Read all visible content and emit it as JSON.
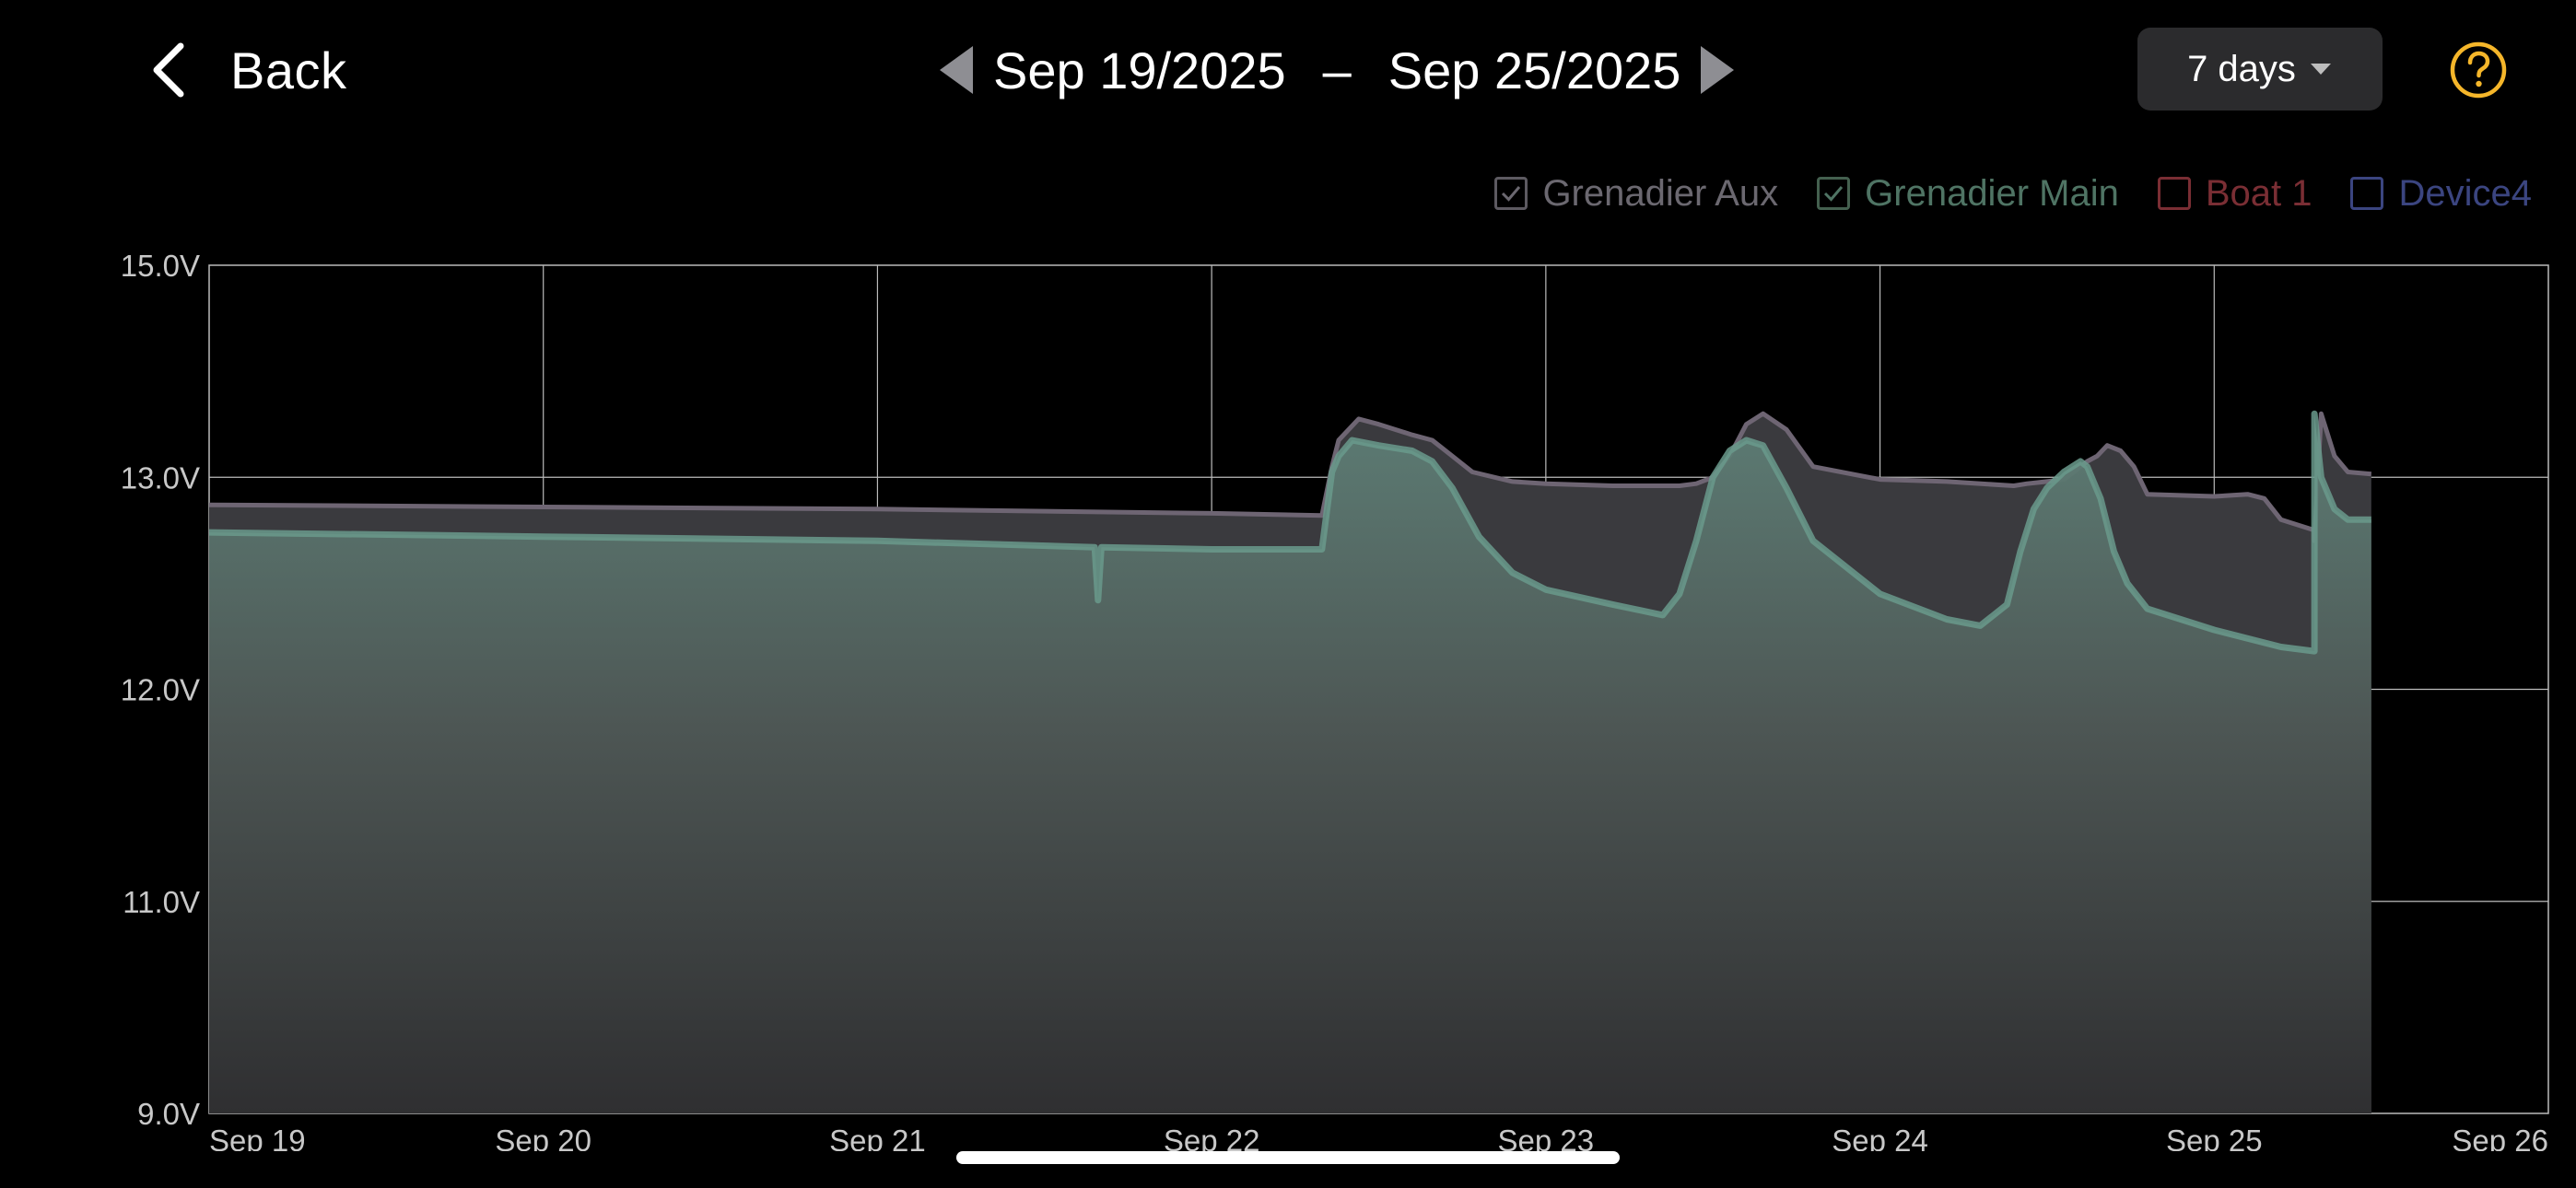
{
  "header": {
    "back_label": "Back",
    "date_from": "Sep 19/2025",
    "date_separator": "–",
    "date_to": "Sep 25/2025",
    "period_label": "7 days",
    "back_icon": "chevron-left-icon",
    "prev_icon": "triangle-left-icon",
    "next_icon": "triangle-right-icon",
    "help_icon": "question-circle-icon"
  },
  "legend": [
    {
      "label": "Grenadier Aux",
      "checked": true,
      "color": "#8a8090"
    },
    {
      "label": "Grenadier Main",
      "checked": true,
      "color": "#5f8f7d"
    },
    {
      "label": "Boat 1",
      "checked": false,
      "color": "#b03e46"
    },
    {
      "label": "Device4",
      "checked": false,
      "color": "#4a5aa8"
    }
  ],
  "colors": {
    "background": "#000000",
    "help_accent": "#f5b62a",
    "aux_fill": "#3a3a3e",
    "main_line": "#6a9a8c",
    "grid": "#bbbbbb"
  },
  "chart_data": {
    "type": "area",
    "title": "",
    "xlabel": "",
    "ylabel": "",
    "x_ticks": [
      "Sep 19",
      "Sep 20",
      "Sep 21",
      "Sep 22",
      "Sep 23",
      "Sep 24",
      "Sep 25",
      "Sep 26"
    ],
    "y_ticks": [
      "9.0V",
      "11.0V",
      "12.0V",
      "13.0V",
      "15.0V"
    ],
    "y_tick_values": [
      9.0,
      11.0,
      12.0,
      13.0,
      15.0
    ],
    "y_scale": "piecewise-nonuniform (labels 9.0, 11.0, 12.0, 13.0, 15.0 at equal spacing)",
    "grid": true,
    "legend_position": "top-right",
    "x_unit": "days since Sep 19 00:00",
    "series": [
      {
        "name": "Grenadier Aux",
        "x": [
          0,
          1,
          2,
          3,
          3.33,
          3.36,
          3.38,
          3.44,
          3.5,
          3.6,
          3.66,
          3.72,
          3.78,
          3.9,
          4.0,
          4.2,
          4.4,
          4.45,
          4.5,
          4.55,
          4.6,
          4.65,
          4.72,
          4.8,
          5.0,
          5.2,
          5.4,
          5.44,
          5.5,
          5.55,
          5.58,
          5.62,
          5.65,
          5.68,
          5.72,
          5.76,
          5.8,
          6.0,
          6.1,
          6.15,
          6.2,
          6.3,
          6.3,
          6.32,
          6.36,
          6.4,
          6.47
        ],
        "y": [
          12.87,
          12.86,
          12.85,
          12.83,
          12.82,
          13.1,
          13.35,
          13.55,
          13.5,
          13.4,
          13.35,
          13.2,
          13.05,
          12.98,
          12.97,
          12.96,
          12.96,
          12.97,
          13.0,
          13.2,
          13.5,
          13.6,
          13.45,
          13.1,
          12.99,
          12.98,
          12.96,
          12.97,
          12.98,
          12.99,
          13.05,
          13.15,
          13.2,
          13.3,
          13.25,
          13.1,
          12.92,
          12.91,
          12.92,
          12.9,
          12.8,
          12.75,
          12.7,
          13.6,
          13.2,
          13.05,
          13.03
        ]
      },
      {
        "name": "Grenadier Main",
        "x": [
          0,
          1,
          2,
          2.65,
          2.66,
          2.67,
          3,
          3.33,
          3.36,
          3.38,
          3.42,
          3.5,
          3.6,
          3.66,
          3.72,
          3.8,
          3.9,
          4.0,
          4.2,
          4.35,
          4.4,
          4.45,
          4.5,
          4.55,
          4.6,
          4.65,
          4.72,
          4.8,
          5.0,
          5.2,
          5.3,
          5.38,
          5.42,
          5.46,
          5.5,
          5.55,
          5.6,
          5.62,
          5.66,
          5.7,
          5.74,
          5.8,
          6.0,
          6.2,
          6.3,
          6.3,
          6.32,
          6.36,
          6.4,
          6.47
        ],
        "y": [
          12.74,
          12.72,
          12.7,
          12.67,
          12.42,
          12.67,
          12.66,
          12.66,
          13.05,
          13.2,
          13.35,
          13.3,
          13.25,
          13.15,
          12.95,
          12.72,
          12.55,
          12.47,
          12.4,
          12.35,
          12.45,
          12.7,
          13.0,
          13.25,
          13.35,
          13.3,
          12.95,
          12.7,
          12.45,
          12.33,
          12.3,
          12.4,
          12.65,
          12.85,
          12.95,
          13.05,
          13.15,
          13.1,
          12.9,
          12.65,
          12.5,
          12.38,
          12.28,
          12.2,
          12.18,
          13.6,
          13.0,
          12.85,
          12.8,
          12.8
        ]
      }
    ]
  }
}
